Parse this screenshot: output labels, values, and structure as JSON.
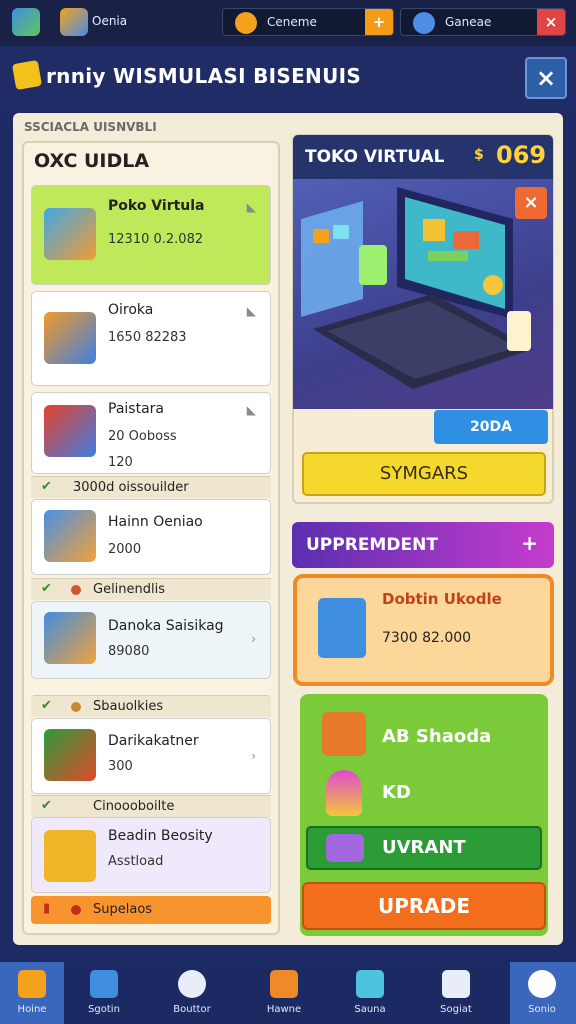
{
  "topbar": {
    "app_label": "Oenia",
    "chip1_label": "Ceneme",
    "chip1_button": "+",
    "chip2_label": "Ganeae",
    "chip2_button": "×"
  },
  "title": "rnniy WISMULASI BISENUIS",
  "close_symbol": "×",
  "main_header": "SSCIACLA UISNVBLI",
  "left_panel": {
    "section_title": "OXC UIDLA",
    "cards": [
      {
        "name": "Poko Virtula",
        "value": "12310 0.2.082",
        "arrow": "◣"
      },
      {
        "name": "Oiroka",
        "value": "1650 82283",
        "arrow": "◣"
      },
      {
        "name": "Paistara",
        "value": "20 Ooboss",
        "extra": "120",
        "arrow": "◣"
      },
      {
        "name": "Hainn Oeniao",
        "value": "2000"
      },
      {
        "name": "Danoka Saisikag",
        "value": "89080",
        "arrow": "›"
      },
      {
        "name": "Darikakatner",
        "value": "300",
        "arrow": "›"
      },
      {
        "name": "Beadin Beosity",
        "value": "Asstload"
      }
    ],
    "strips": [
      {
        "check": "✔",
        "label": "3000d oissouilder"
      },
      {
        "check": "✔",
        "label": "Gelinendlis"
      },
      {
        "check": "✔",
        "label": "Sbauolkies"
      },
      {
        "check": "✔",
        "label": "Cinoooboilte"
      },
      {
        "check": "✔",
        "label": "Supelaos"
      }
    ]
  },
  "shop": {
    "title": "TOKO VIRTUAL",
    "coin_symbol": "$",
    "amount": "069",
    "close_symbol": "×",
    "price_tag": "20DA",
    "buy_label": "SYMGARS"
  },
  "upgrade_panel": {
    "bar_label": "UPPREMDENT",
    "bar_icon": "+",
    "item_name": "Dobtin Ukodle",
    "item_value": "7300 82.000",
    "row1_label": "AB Shaoda",
    "row2_label": "KD",
    "button_label": "UVRANT",
    "upgrade_label": "UPRADE"
  },
  "nav": [
    {
      "label": "Hoine"
    },
    {
      "label": "Sgotin"
    },
    {
      "label": "Bouttor"
    },
    {
      "label": "Hawne"
    },
    {
      "label": "Sauna"
    },
    {
      "label": "Sogiat"
    },
    {
      "label": "Sonio"
    }
  ]
}
